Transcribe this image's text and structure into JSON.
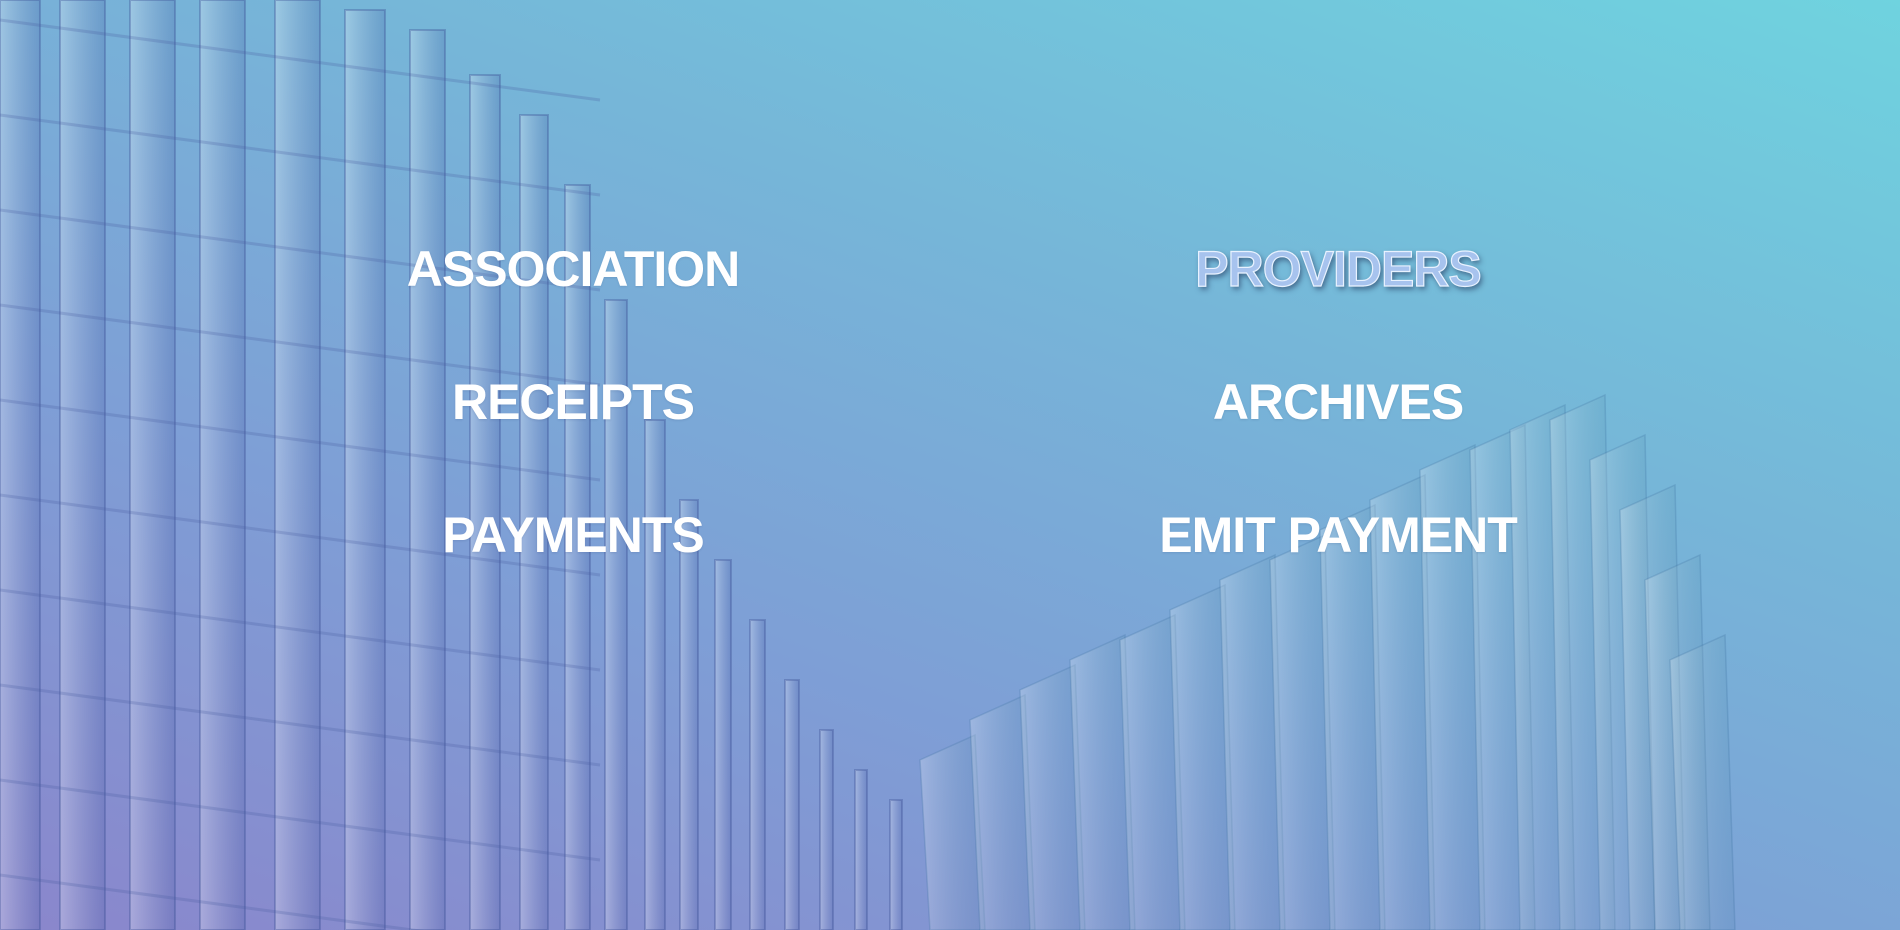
{
  "background": {
    "gradient_colors": [
      "#6fd3df",
      "#76b6d8",
      "#7e9fd6",
      "#8a86cc"
    ],
    "image": "modern-architecture-facade"
  },
  "menu": {
    "items": [
      {
        "label": "ASSOCIATION",
        "id": "association",
        "active": false
      },
      {
        "label": "PROVIDERS",
        "id": "providers",
        "active": true
      },
      {
        "label": "RECEIPTS",
        "id": "receipts",
        "active": false
      },
      {
        "label": "ARCHIVES",
        "id": "archives",
        "active": false
      },
      {
        "label": "PAYMENTS",
        "id": "payments",
        "active": false
      },
      {
        "label": "EMIT PAYMENT",
        "id": "emit-payment",
        "active": false
      }
    ],
    "active_color": "#a7c3ee",
    "text_color": "#ffffff"
  }
}
